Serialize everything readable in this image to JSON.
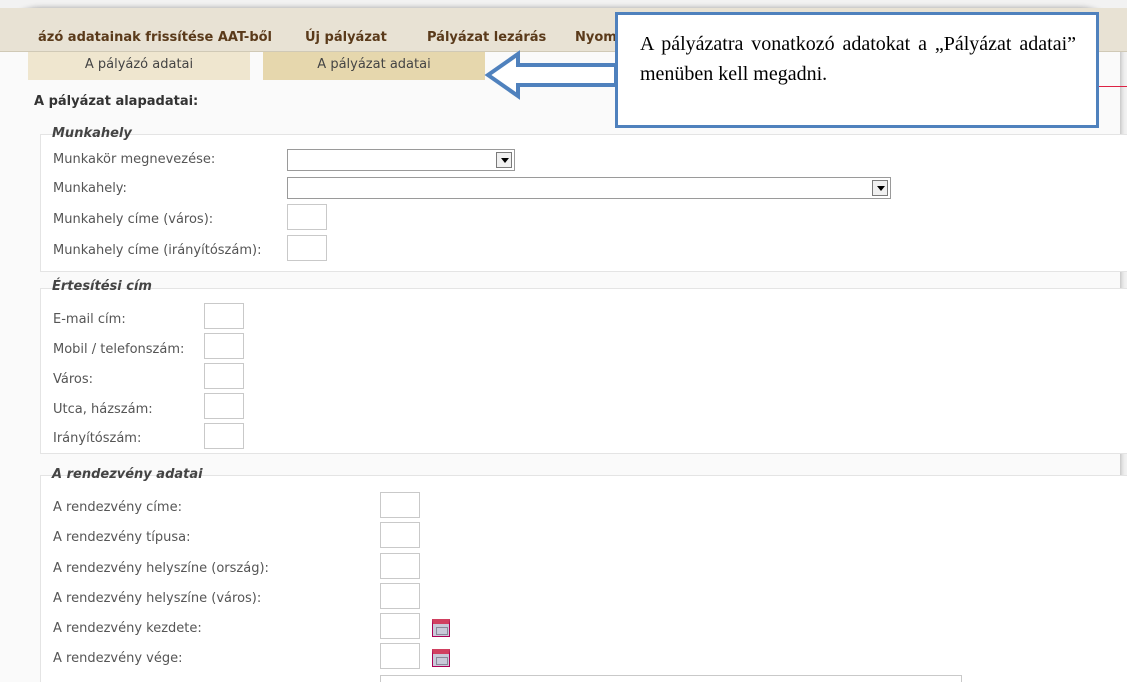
{
  "menu": {
    "items": [
      "ázó adatainak frissítése AAT-ből",
      "Új pályázat",
      "Pályázat lezárás",
      "Nyom"
    ]
  },
  "tabs": {
    "applicant": "A pályázó adatai",
    "application": "A pályázat adatai"
  },
  "section_title": "A pályázat alapadatai:",
  "workplace": {
    "legend": "Munkahely",
    "job_title_label": "Munkakör megnevezése:",
    "workplace_label": "Munkahely:",
    "city_label": "Munkahely címe (város):",
    "zip_label": "Munkahely címe (irányítószám):"
  },
  "notification": {
    "legend": "Értesítési cím",
    "email_label": "E-mail cím:",
    "phone_label": "Mobil / telefonszám:",
    "city_label": "Város:",
    "street_label": "Utca, házszám:",
    "zip_label": "Irányítószám:"
  },
  "event": {
    "legend": "A rendezvény adatai",
    "title_label": "A rendezvény címe:",
    "type_label": "A rendezvény típusa:",
    "country_label": "A rendezvény helyszíne (ország):",
    "city_label": "A rendezvény helyszíne (város):",
    "start_label": "A rendezvény kezdete:",
    "end_label": "A rendezvény vége:"
  },
  "callout": {
    "text": "A pályázatra vonatkozó adatokat a „Pályázat adatai” menüben kell megadni."
  },
  "colors": {
    "callout_border": "#4f81bd",
    "menu_text": "#5a3a1a",
    "tab_active": "#e6d7ad"
  }
}
